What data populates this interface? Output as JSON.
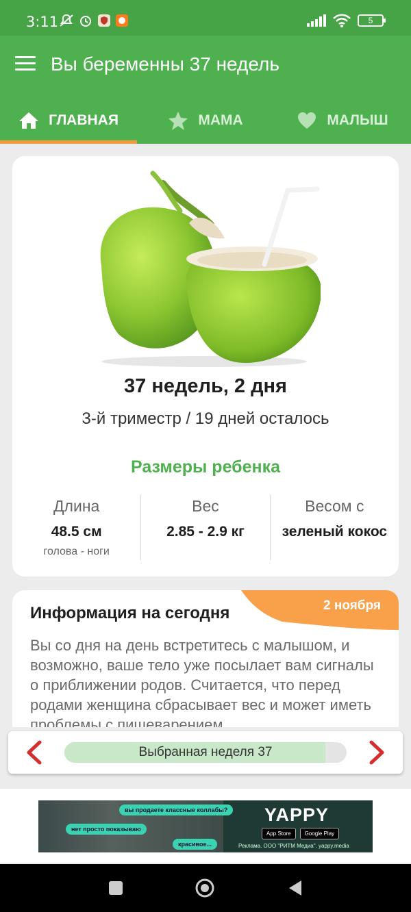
{
  "status_bar": {
    "time": "3:11",
    "battery": "5"
  },
  "app_bar": {
    "title": "Вы беременны 37 недель"
  },
  "tabs": [
    {
      "label": "ГЛАВНАЯ",
      "icon": "home-icon",
      "active": true
    },
    {
      "label": "МАМА",
      "icon": "star-icon",
      "active": false
    },
    {
      "label": "МАЛЫШ",
      "icon": "heart-icon",
      "active": false
    }
  ],
  "main_card": {
    "image": "coconut",
    "week_title": "37 недель, 2 дня",
    "week_subtitle": "3-й триместр / 19 дней осталось",
    "sizes_title": "Размеры ребенка",
    "stats": [
      {
        "label": "Длина",
        "value": "48.5 см",
        "note": "голова - ноги"
      },
      {
        "label": "Вес",
        "value": "2.85 - 2.9 кг",
        "note": ""
      },
      {
        "label": "Весом с",
        "value": "зеленый кокос",
        "note": ""
      }
    ]
  },
  "info_card": {
    "title": "Информация на сегодня",
    "date": "2 ноября",
    "text": "Вы со дня на день встретитесь с малышом, и возможно, ваше тело уже посылает вам сигналы о приближении родов. Считается, что перед родами женщина сбрасывает вес и может иметь проблемы с пищеварением"
  },
  "week_selector": {
    "label": "Выбранная неделя 37",
    "progress": 0.925
  },
  "ad": {
    "logo": "YAPPY",
    "bubbles": [
      "вы продаете классные коллабы?",
      "нет просто показываю",
      "красивое..."
    ],
    "store_buttons": [
      "App Store",
      "Google Play"
    ],
    "legal": "Реклама. ООО \"РИТМ Медиа\". yappy.media"
  },
  "colors": {
    "primary": "#4fb04f",
    "status": "#46a346",
    "accent": "#f59a3c",
    "arrow": "#d32f2f"
  }
}
